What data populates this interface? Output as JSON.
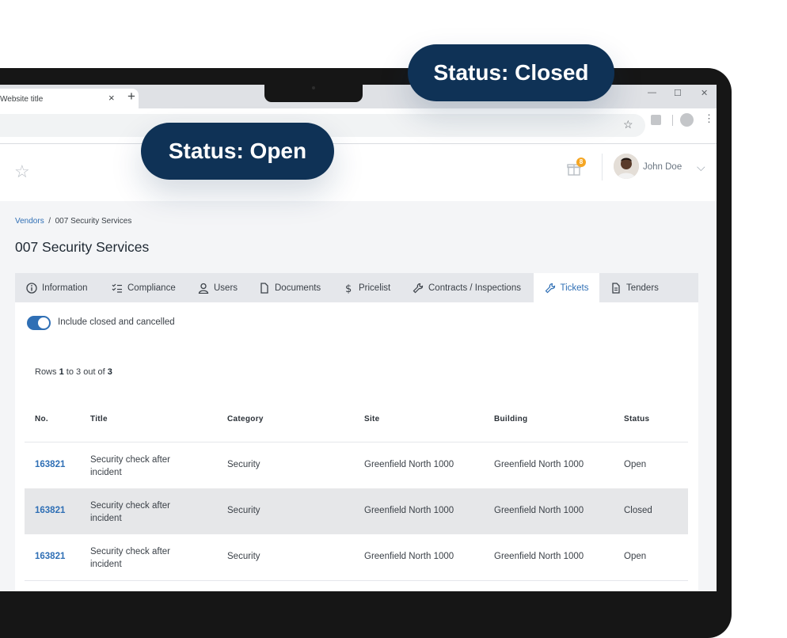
{
  "callouts": {
    "open": "Status: Open",
    "closed": "Status: Closed"
  },
  "browser": {
    "tab_title": "Website title",
    "close_glyph": "×",
    "new_tab_glyph": "+",
    "minimize_glyph": "—",
    "maximize_glyph": "☐",
    "close_window_glyph": "✕",
    "bookmark_glyph": "☆",
    "menu_glyph": "⋮"
  },
  "header": {
    "favorite_glyph": "☆",
    "notification_count": "8",
    "user_name": "John Doe",
    "chevron_glyph": "⌵"
  },
  "breadcrumb": {
    "parent": "Vendors",
    "separator": "/",
    "current": "007 Security Services"
  },
  "page_title": "007 Security Services",
  "tabs": [
    {
      "label": "Information",
      "icon": "info-icon"
    },
    {
      "label": "Compliance",
      "icon": "checklist-icon"
    },
    {
      "label": "Users",
      "icon": "user-icon"
    },
    {
      "label": "Documents",
      "icon": "document-icon"
    },
    {
      "label": "Pricelist",
      "icon": "dollar-icon"
    },
    {
      "label": "Contracts / Inspections",
      "icon": "wrench-icon"
    },
    {
      "label": "Tickets",
      "icon": "wrench-icon",
      "active": true
    },
    {
      "label": "Tenders",
      "icon": "file-text-icon"
    }
  ],
  "filter": {
    "toggle_label": "Include closed and cancelled",
    "toggle_on": true
  },
  "rows_info": {
    "prefix": "Rows",
    "from": "1",
    "to_word": "to",
    "to": "3",
    "out_of": "out of",
    "total": "3"
  },
  "table": {
    "columns": [
      "No.",
      "Title",
      "Category",
      "Site",
      "Building",
      "Status"
    ],
    "rows": [
      {
        "no": "163821",
        "title": "Security check after incident",
        "category": "Security",
        "site": "Greenfield North 1000",
        "building": "Greenfield North 1000",
        "status": "Open"
      },
      {
        "no": "163821",
        "title": "Security check after incident",
        "category": "Security",
        "site": "Greenfield North 1000",
        "building": "Greenfield North 1000",
        "status": "Closed"
      },
      {
        "no": "163821",
        "title": "Security check after incident",
        "category": "Security",
        "site": "Greenfield North 1000",
        "building": "Greenfield North 1000",
        "status": "Open"
      }
    ]
  },
  "colors": {
    "accent": "#2f6fb5",
    "callout_bg": "#0f3256",
    "badge": "#f5a623"
  }
}
